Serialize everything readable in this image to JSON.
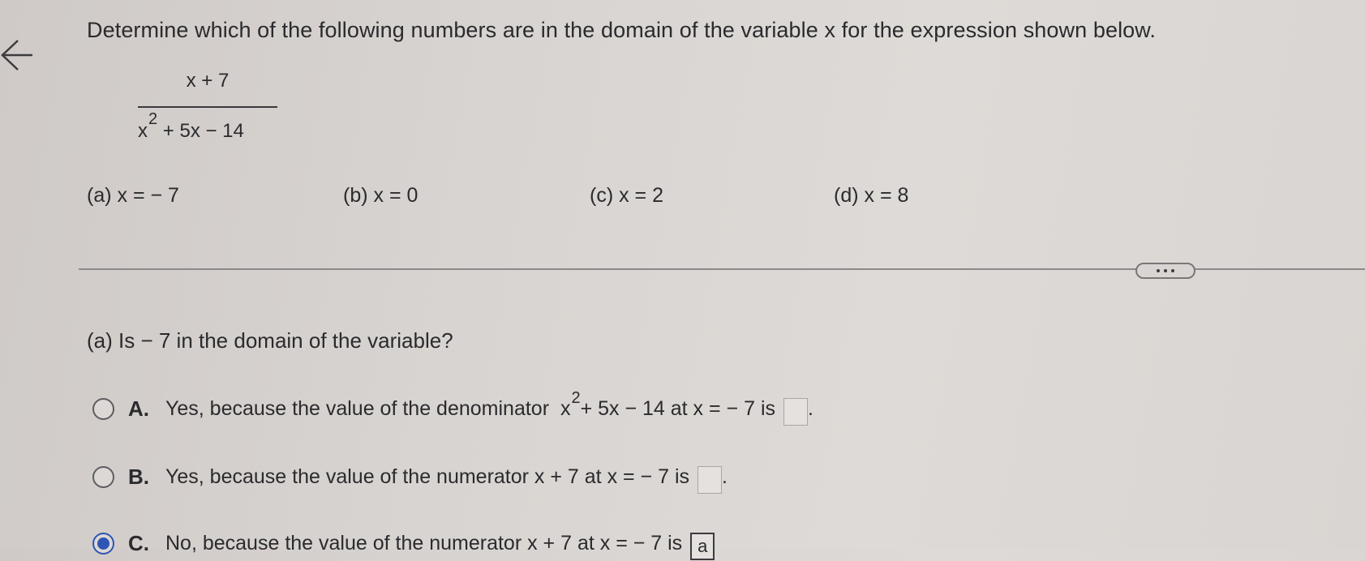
{
  "question": {
    "prompt": "Determine which of the following numbers are in the domain of the variable x for the expression shown below.",
    "numerator": "x + 7",
    "denominator_base": "x",
    "denominator_exp": "2",
    "denominator_rest": "+ 5x − 14"
  },
  "choices": [
    {
      "label": "(a)",
      "value": "x = − 7"
    },
    {
      "label": "(b)",
      "value": "x = 0"
    },
    {
      "label": "(c)",
      "value": "x = 2"
    },
    {
      "label": "(d)",
      "value": "x = 8"
    }
  ],
  "part_a": {
    "question": "(a) Is  − 7 in the domain of the variable?",
    "options": [
      {
        "letter": "A.",
        "text_before": "Yes, because the value of the denominator ",
        "expr_base": "x",
        "expr_exp": "2",
        "text_after": " + 5x − 14 at x = − 7 is",
        "box_value": "",
        "trailing": ".",
        "selected": false
      },
      {
        "letter": "B.",
        "text_before": "Yes, because the value of the numerator x + 7 at x = − 7 is",
        "box_value": "",
        "trailing": ".",
        "selected": false
      },
      {
        "letter": "C.",
        "text_before": "No, because the value of the numerator x + 7 at x = − 7 is",
        "box_value": "a",
        "trailing": "",
        "selected": true
      }
    ]
  },
  "colors": {
    "accent": "#2e55b3",
    "text": "#2b2a2d",
    "background": "#d8d4d1"
  },
  "icons": {
    "back": "arrow-left-icon",
    "more": "more-dots-icon"
  }
}
